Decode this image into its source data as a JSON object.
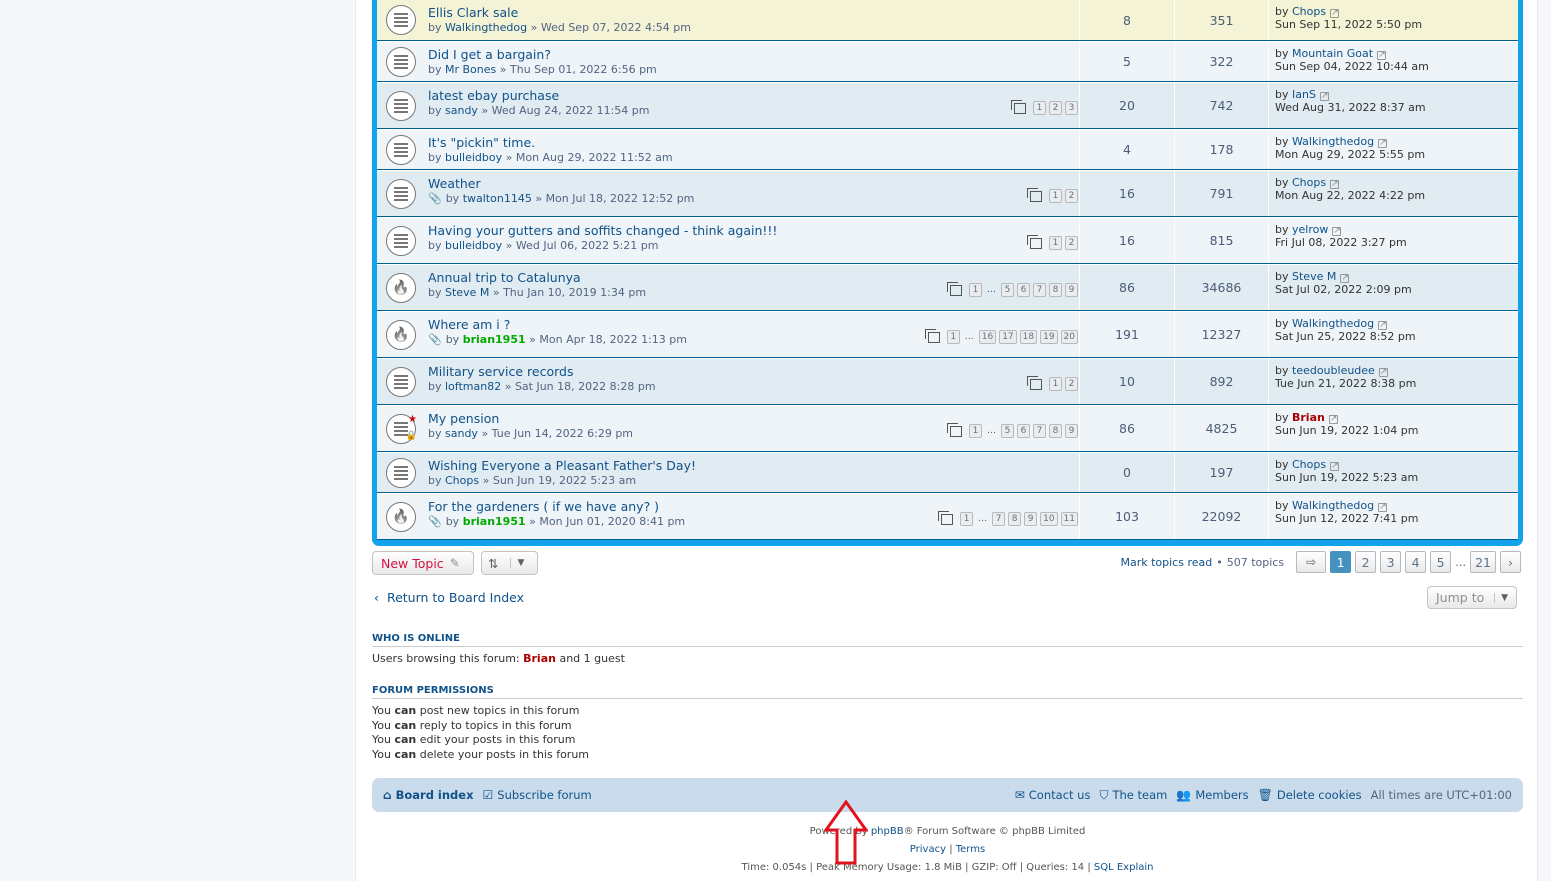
{
  "topics": [
    {
      "title": "Ellis Clark sale",
      "author": "Walkingthedog",
      "date": "Wed Sep 07, 2022 4:54 pm",
      "posts": "8",
      "views": "351",
      "last_by": "Chops",
      "last_date": "Sun Sep 11, 2022 5:50 pm",
      "icon": "topic-read-icon",
      "pages": []
    },
    {
      "title": "Did I get a bargain?",
      "author": "Mr Bones",
      "date": "Thu Sep 01, 2022 6:56 pm",
      "posts": "5",
      "views": "322",
      "last_by": "Mountain Goat",
      "last_date": "Sun Sep 04, 2022 10:44 am",
      "icon": "topic-read-icon",
      "pages": []
    },
    {
      "title": "latest ebay purchase",
      "author": "sandy",
      "date": "Wed Aug 24, 2022 11:54 pm",
      "posts": "20",
      "views": "742",
      "last_by": "IanS",
      "last_date": "Wed Aug 31, 2022 8:37 am",
      "icon": "topic-read-icon",
      "pages": [
        "1",
        "2",
        "3"
      ]
    },
    {
      "title": "It's \"pickin\" time.",
      "author": "bulleidboy",
      "date": "Mon Aug 29, 2022 11:52 am",
      "posts": "4",
      "views": "178",
      "last_by": "Walkingthedog",
      "last_date": "Mon Aug 29, 2022 5:55 pm",
      "icon": "topic-read-icon",
      "pages": []
    },
    {
      "title": "Weather",
      "author": "twalton1145",
      "date": "Mon Jul 18, 2022 12:52 pm",
      "posts": "16",
      "views": "791",
      "last_by": "Chops",
      "last_date": "Mon Aug 22, 2022 4:22 pm",
      "icon": "topic-read-icon",
      "attach": true,
      "pages": [
        "1",
        "2"
      ]
    },
    {
      "title": "Having your gutters and soffits changed - think again!!!",
      "author": "bulleidboy",
      "date": "Wed Jul 06, 2022 5:21 pm",
      "posts": "16",
      "views": "815",
      "last_by": "yelrow",
      "last_date": "Fri Jul 08, 2022 3:27 pm",
      "icon": "topic-read-icon",
      "pages": [
        "1",
        "2"
      ]
    },
    {
      "title": "Annual trip to Catalunya",
      "author": "Steve M",
      "date": "Thu Jan 10, 2019 1:34 pm",
      "posts": "86",
      "views": "34686",
      "last_by": "Steve M",
      "last_date": "Sat Jul 02, 2022 2:09 pm",
      "icon": "hot-topic-icon",
      "pages": [
        "1",
        "…",
        "5",
        "6",
        "7",
        "8",
        "9"
      ]
    },
    {
      "title": "Where am i ?",
      "author": "brian1951",
      "author_green": true,
      "date": "Mon Apr 18, 2022 1:13 pm",
      "posts": "191",
      "views": "12327",
      "last_by": "Walkingthedog",
      "last_date": "Sat Jun 25, 2022 8:52 pm",
      "icon": "hot-topic-icon",
      "attach": true,
      "pages": [
        "1",
        "…",
        "16",
        "17",
        "18",
        "19",
        "20"
      ]
    },
    {
      "title": "Military service records",
      "author": "loftman82",
      "date": "Sat Jun 18, 2022 8:28 pm",
      "posts": "10",
      "views": "892",
      "last_by": "teedoubleudee",
      "last_date": "Tue Jun 21, 2022 8:38 pm",
      "icon": "topic-read-icon",
      "pages": [
        "1",
        "2"
      ]
    },
    {
      "title": "My pension",
      "author": "sandy",
      "date": "Tue Jun 14, 2022 6:29 pm",
      "posts": "86",
      "views": "4825",
      "last_by": "Brian",
      "last_red": true,
      "last_date": "Sun Jun 19, 2022 1:04 pm",
      "icon": "locked-topic-icon",
      "pages": [
        "1",
        "…",
        "5",
        "6",
        "7",
        "8",
        "9"
      ]
    },
    {
      "title": "Wishing Everyone a Pleasant Father's Day!",
      "author": "Chops",
      "date": "Sun Jun 19, 2022 5:23 am",
      "posts": "0",
      "views": "197",
      "last_by": "Chops",
      "last_date": "Sun Jun 19, 2022 5:23 am",
      "icon": "topic-read-icon",
      "pages": []
    },
    {
      "title": "For the gardeners ( if we have any? )",
      "author": "brian1951",
      "author_green": true,
      "date": "Mon Jun 01, 2020 8:41 pm",
      "posts": "103",
      "views": "22092",
      "last_by": "Walkingthedog",
      "last_date": "Sun Jun 12, 2022 7:41 pm",
      "icon": "hot-topic-icon",
      "attach": true,
      "pages": [
        "1",
        "…",
        "7",
        "8",
        "9",
        "10",
        "11"
      ]
    }
  ],
  "labels": {
    "by": "by",
    "sep": "»"
  },
  "actions": {
    "new_topic": "New Topic"
  },
  "pagination": {
    "mark_read": "Mark topics read",
    "sep": "•",
    "count": "507 topics",
    "pages": [
      "1",
      "2",
      "3",
      "4",
      "5"
    ],
    "ellipsis": "…",
    "last": "21"
  },
  "return_link": "Return to Board Index",
  "jump_to": "Jump to",
  "who_online": {
    "heading": "WHO IS ONLINE",
    "prefix": "Users browsing this forum:",
    "user": "Brian",
    "suffix": "and 1 guest"
  },
  "permissions": {
    "heading": "FORUM PERMISSIONS",
    "you": "You",
    "can": "can",
    "lines": [
      "post new topics in this forum",
      "reply to topics in this forum",
      "edit your posts in this forum",
      "delete your posts in this forum"
    ]
  },
  "navbar": {
    "board_index": "Board index",
    "subscribe": "Subscribe forum",
    "contact": "Contact us",
    "team": "The team",
    "members": "Members",
    "delete_cookies": "Delete cookies",
    "timezone": "All times are UTC+01:00"
  },
  "footer": {
    "powered_pre": "Powered by",
    "phpbb": "phpBB",
    "powered_post": "® Forum Software © phpBB Limited",
    "privacy": "Privacy",
    "pipe": "|",
    "terms": "Terms",
    "stats": "Time: 0.054s | Peak Memory Usage: 1.8 MiB | GZIP: Off | Queries: 14 |",
    "sql": "SQL Explain"
  },
  "colors": {
    "accent": "#12a3eb",
    "link": "#105289",
    "arrow": "#e0131d"
  }
}
